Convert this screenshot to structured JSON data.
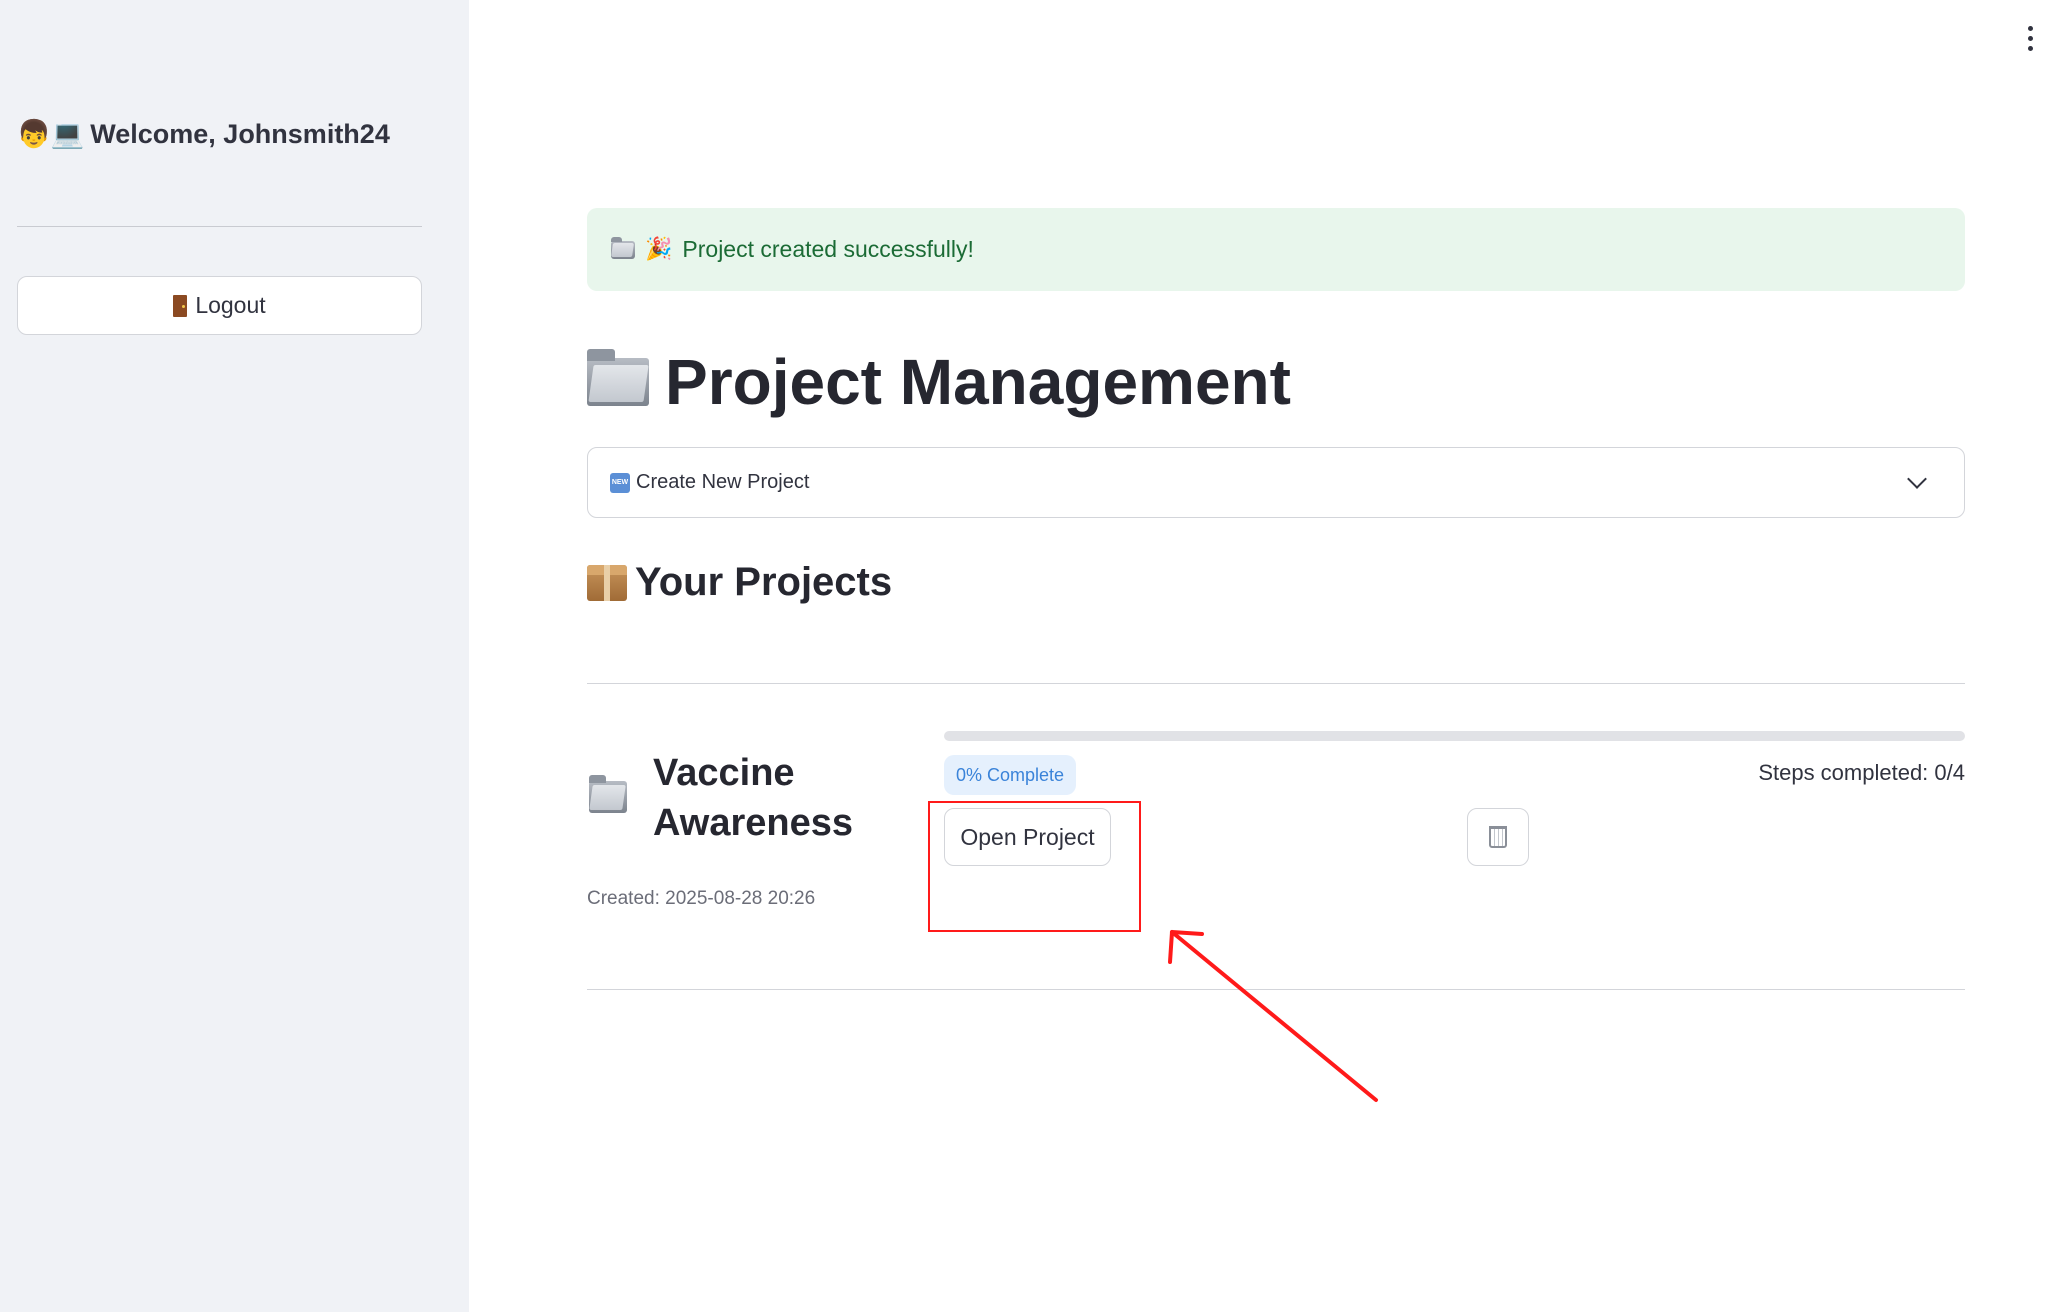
{
  "sidebar": {
    "welcome_emoji": "👦💻",
    "welcome_text": "Welcome, Johnsmith24",
    "logout_label": "Logout",
    "logout_icon": "door-icon"
  },
  "menu": {
    "icon": "kebab-menu-icon"
  },
  "alert": {
    "icon": "folder-icon",
    "emoji": "🎉",
    "message": "Project created successfully!",
    "color": "#1b6b35",
    "background": "#e8f6ec"
  },
  "page": {
    "title": "Project Management",
    "title_icon": "folder-icon"
  },
  "create_expander": {
    "badge": "NEW",
    "label": "Create New Project",
    "icon": "chevron-down-icon"
  },
  "projects_section": {
    "title": "Your Projects",
    "icon": "package-icon"
  },
  "projects": [
    {
      "name": "Vaccine Awareness",
      "created": "Created: 2025-08-28 20:26",
      "progress_fraction": 0,
      "progress_label": "0% Complete",
      "steps_label": "Steps completed: 0/4",
      "open_label": "Open Project",
      "delete_icon": "trash-icon"
    }
  ],
  "annotation": {
    "color": "#ff1a1a"
  }
}
